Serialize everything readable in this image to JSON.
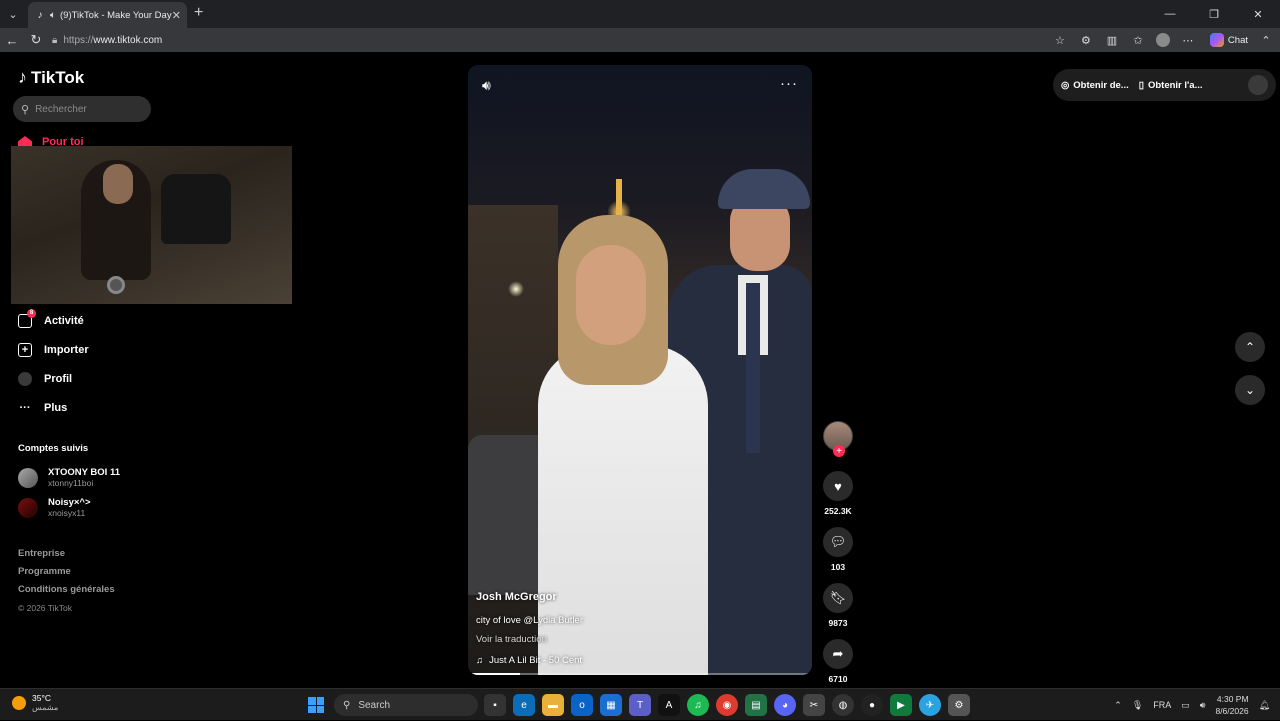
{
  "browser": {
    "tab_title": "(9)TikTok - Make Your Day",
    "url_protocol": "https://",
    "url_host": "www.tiktok.com",
    "chat_label": "Chat"
  },
  "sidebar": {
    "brand": "TikTok",
    "search_placeholder": "Rechercher",
    "for_you": "Pour toi",
    "items": [
      {
        "label": "Activité",
        "icon": "inbox-icon",
        "badge": "8"
      },
      {
        "label": "Importer",
        "icon": "upload-plus-icon"
      },
      {
        "label": "Profil",
        "icon": "profile-avatar"
      },
      {
        "label": "Plus",
        "icon": "more-dots-icon"
      }
    ],
    "following_title": "Comptes suivis",
    "following": [
      {
        "name": "XTOONY BOI 11",
        "username": "xtonny11boi"
      },
      {
        "name": "Noisy×^>",
        "username": "xnoisyx11"
      }
    ],
    "footer": [
      "Entreprise",
      "Programme",
      "Conditions générales"
    ],
    "copyright": "© 2026 TikTok"
  },
  "video": {
    "author": "Josh McGregor",
    "description": "city of love @Lydia Butler",
    "translate": "Voir la traduction",
    "music": "Just A Lil Bit - 50 Cent",
    "progress": 0.15
  },
  "actions": {
    "likes": "252.3K",
    "comments": "103",
    "saves": "9873",
    "shares": "6710"
  },
  "topbar": {
    "coins": "Obtenir de...",
    "app": "Obtenir l'a..."
  },
  "taskbar": {
    "temp": "35°C",
    "weather": "مشمس",
    "search": "Search",
    "lang": "FRA",
    "time": "4:30 PM",
    "date": "8/6/2026"
  },
  "colors": {
    "accent": "#fe2c55",
    "background": "#000000"
  }
}
